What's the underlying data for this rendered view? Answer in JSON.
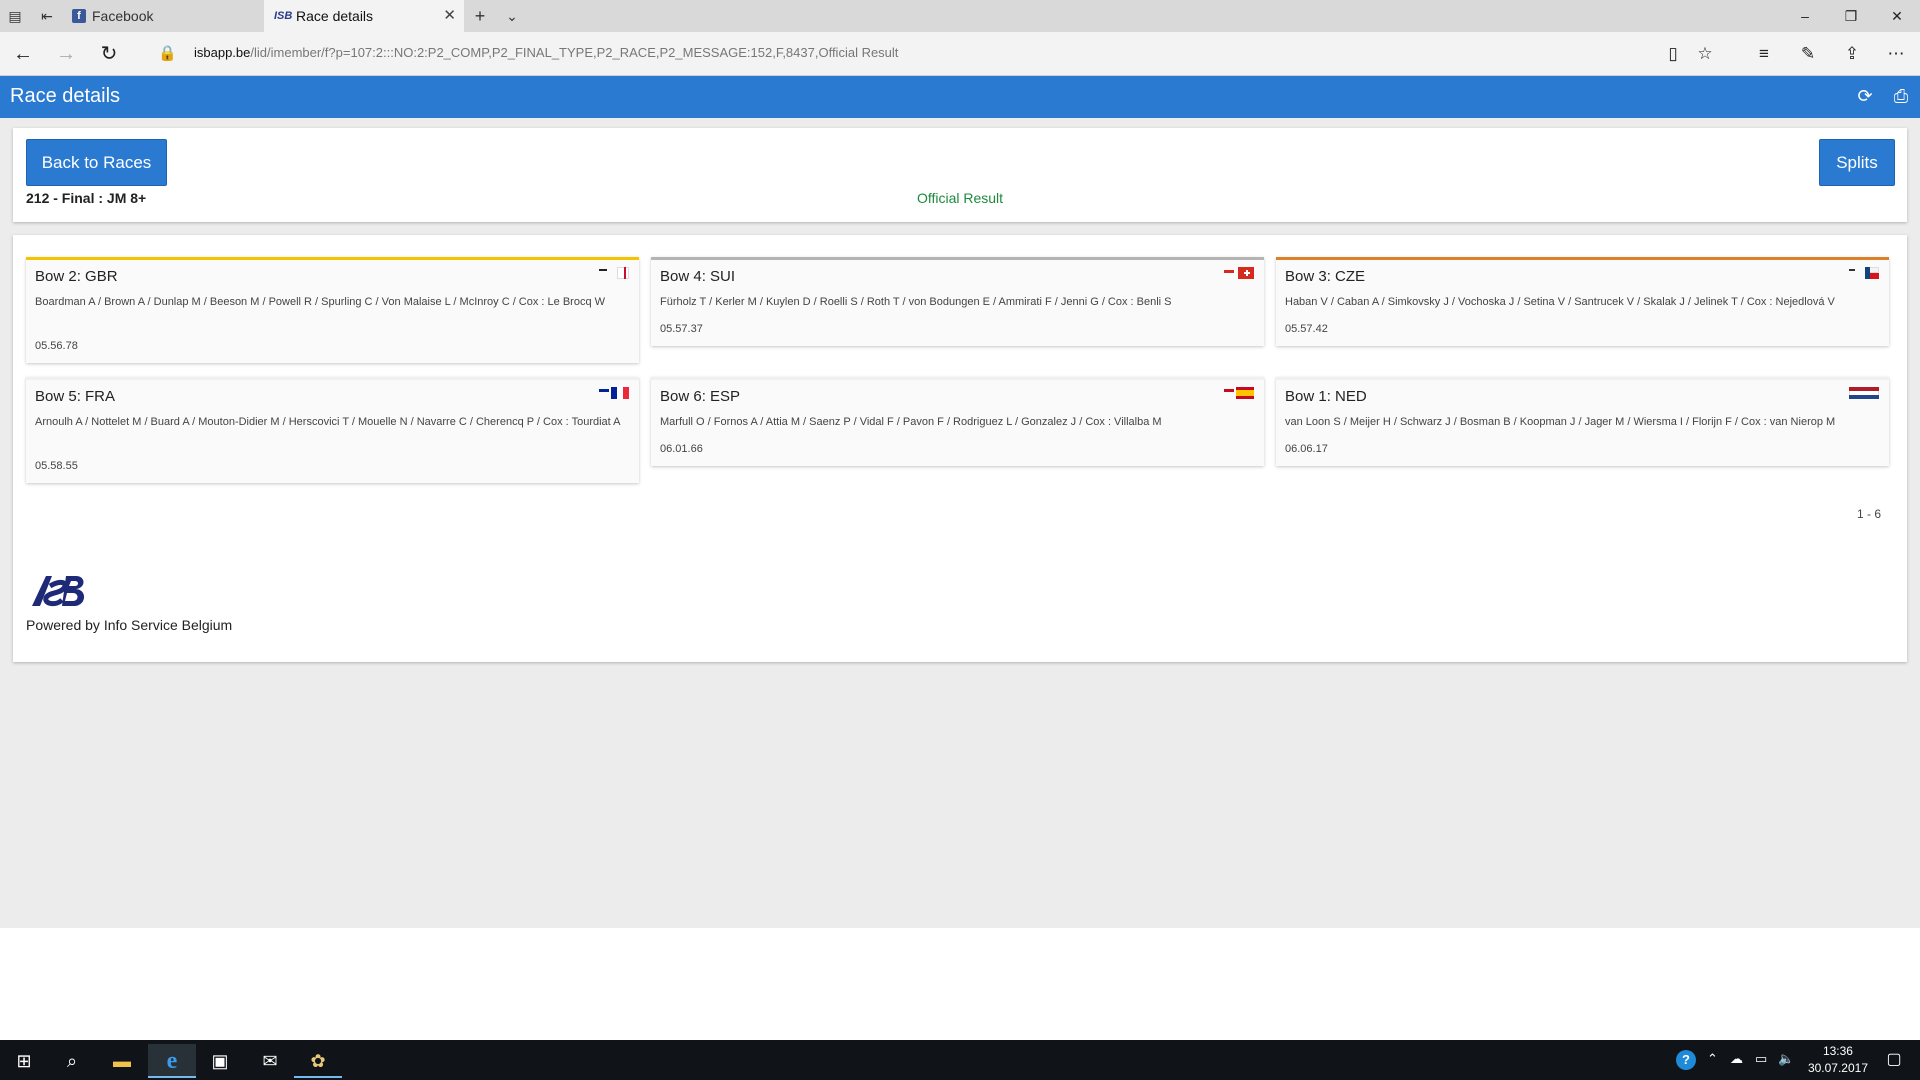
{
  "browser": {
    "tabs": [
      {
        "label": "Facebook",
        "favicon": "facebook-icon"
      },
      {
        "label": "Race details",
        "favicon": "isb-icon"
      }
    ],
    "url_host": "isbapp.be",
    "url_path": "/lid/imember/f?p=107:2:::NO:2:P2_COMP,P2_FINAL_TYPE,P2_RACE,P2_MESSAGE:152,F,8437,Official Result",
    "new_tab_symbol": "+",
    "close_symbol": "✕"
  },
  "app": {
    "title": "Race details",
    "header_color": "#2a7ad2"
  },
  "race": {
    "back_label": "Back to Races",
    "splits_label": "Splits",
    "name": "212 - Final : JM 8+",
    "status": "Official Result",
    "status_color": "#1d8a3d"
  },
  "results": [
    {
      "title": "Bow 2: GBR",
      "crew": "Boardman A / Brown A / Dunlap M / Beeson M / Powell R / Spurling C / Von Malaise L / McInroy C / Cox : Le Brocq W",
      "time": "05.56.78",
      "medal_color": "#f5c400",
      "flag": "GBR"
    },
    {
      "title": "Bow 4: SUI",
      "crew": "Fürholz T / Kerler M / Kuylen D / Roelli S / Roth T / von Bodungen E / Ammirati F / Jenni G / Cox : Benli S",
      "time": "05.57.37",
      "medal_color": "#b4b4b4",
      "flag": "SUI"
    },
    {
      "title": "Bow 3: CZE",
      "crew": "Haban V / Caban A / Simkovsky J / Vochoska J / Setina V / Santrucek V / Skalak J / Jelinek T / Cox : Nejedlová V",
      "time": "05.57.42",
      "medal_color": "#d9822b",
      "flag": "CZE"
    },
    {
      "title": "Bow 5: FRA",
      "crew": "Arnoulh A / Nottelet M / Buard A / Mouton-Didier M / Herscovici T / Mouelle N / Navarre C / Cherencq P / Cox : Tourdiat A",
      "time": "05.58.55",
      "medal_color": "#f0f0f0",
      "flag": "FRA"
    },
    {
      "title": "Bow 6: ESP",
      "crew": "Marfull O / Fornos A / Attia M / Saenz P / Vidal F / Pavon F / Rodriguez L / Gonzalez J / Cox : Villalba M",
      "time": "06.01.66",
      "medal_color": "#f0f0f0",
      "flag": "ESP"
    },
    {
      "title": "Bow 1: NED",
      "crew": "van Loon S / Meijer H / Schwarz J / Bosman B / Koopman J / Jager M / Wiersma I / Florijn F / Cox : van Nierop M",
      "time": "06.06.17",
      "medal_color": "#f0f0f0",
      "flag": "NED"
    }
  ],
  "pager": "1 - 6",
  "footer": {
    "powered_by": "Powered by Info Service Belgium"
  },
  "taskbar": {
    "time": "13:36",
    "date": "30.07.2017"
  }
}
